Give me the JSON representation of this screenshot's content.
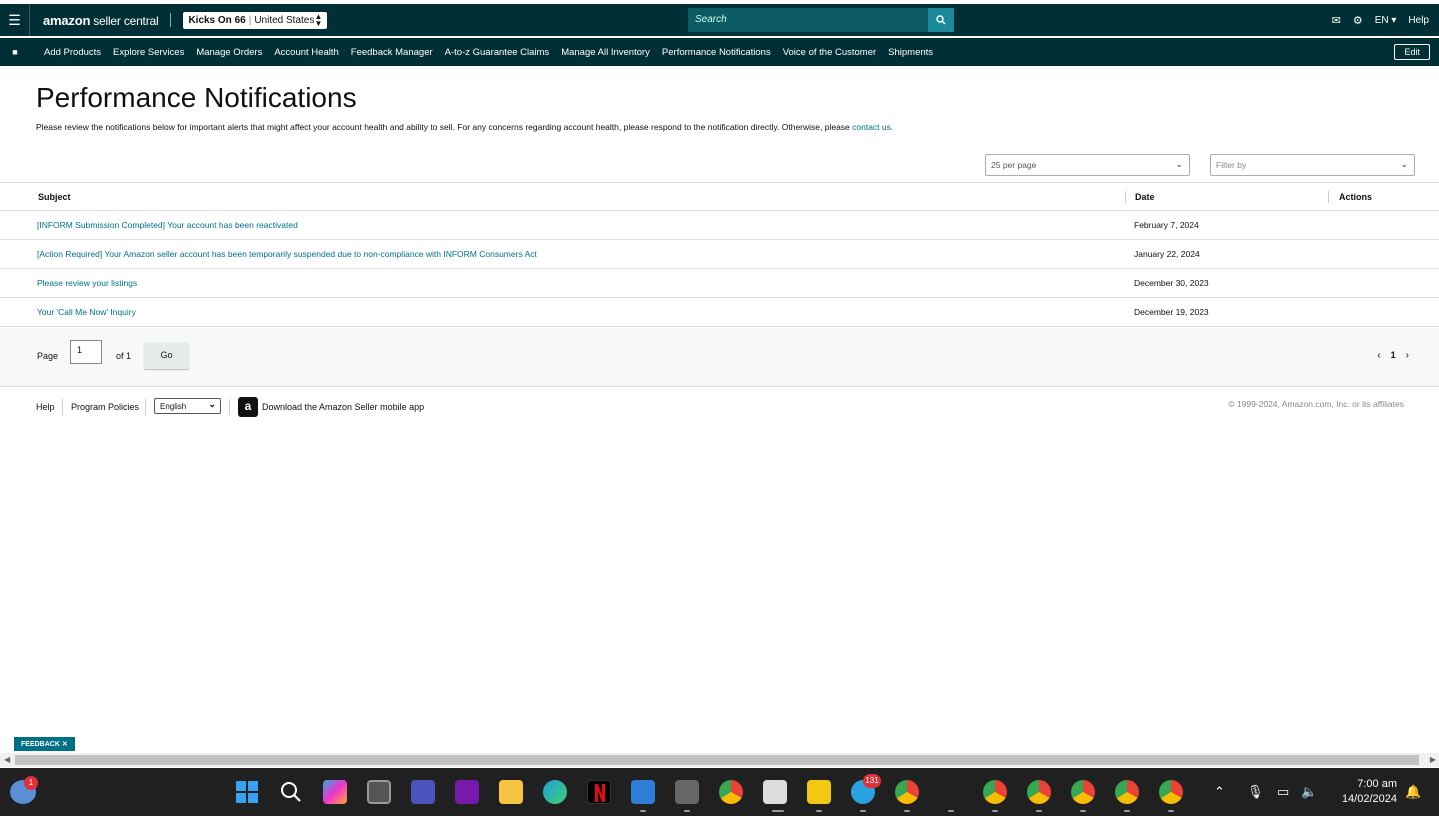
{
  "header": {
    "logo_brand": "amazon",
    "logo_product": "seller central",
    "store_name": "Kicks On 66",
    "store_marketplace": "United States",
    "search_placeholder": "Search",
    "language": "EN",
    "help": "Help"
  },
  "nav": {
    "items": [
      "Add Products",
      "Explore Services",
      "Manage Orders",
      "Account Health",
      "Feedback Manager",
      "A-to-z Guarantee Claims",
      "Manage All Inventory",
      "Performance Notifications",
      "Voice of the Customer",
      "Shipments"
    ],
    "edit_label": "Edit"
  },
  "page": {
    "title": "Performance Notifications",
    "description": "Please review the notifications below for important alerts that might affect your account health and ability to sell. For any concerns regarding account health, please respond to the notification directly. Otherwise, please ",
    "contact_link": "contact us."
  },
  "filters": {
    "per_page": "25 per page",
    "filter_placeholder": "Filter by"
  },
  "table": {
    "columns": [
      "Subject",
      "Date",
      "Actions"
    ],
    "rows": [
      {
        "subject": "[INFORM Submission Completed] Your account has been reactivated",
        "date": "February 7, 2024"
      },
      {
        "subject": "[Action Required] Your Amazon seller account has been temporarily suspended due to non-compliance with INFORM Consumers Act",
        "date": "January 22, 2024"
      },
      {
        "subject": "Please review your listings",
        "date": "December 30, 2023"
      },
      {
        "subject": "Your 'Call Me Now' Inquiry",
        "date": "December 19, 2023"
      }
    ]
  },
  "pager": {
    "page_label": "Page",
    "page_value": "1",
    "of_label": "of 1",
    "go_label": "Go",
    "current": "1"
  },
  "footer": {
    "help": "Help",
    "program_policies": "Program Policies",
    "language": "English",
    "download_app": "Download the Amazon Seller mobile app",
    "copyright": "© 1999-2024, Amazon.com, Inc. or its affiliates"
  },
  "feedback_label": "FEEDBACK ✕",
  "taskbar": {
    "weather_badge": "1",
    "telegram_badge": "131",
    "time": "7:00 am",
    "date": "14/02/2024"
  }
}
